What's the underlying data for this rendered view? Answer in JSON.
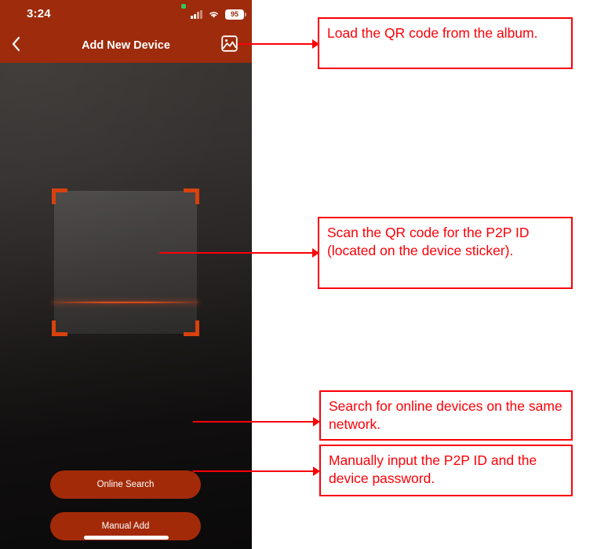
{
  "phone": {
    "status_bar": {
      "time": "3:24",
      "battery_level": "95",
      "signal_icon": "cellular-signal-icon",
      "wifi_icon": "wifi-icon",
      "battery_icon": "battery-icon",
      "privacy_icon": "green-privacy-dot-icon"
    },
    "nav_bar": {
      "title": "Add New Device",
      "back_icon": "chevron-left-icon",
      "album_icon": "photo-album-icon"
    },
    "scanner": {
      "frame_icon": "qr-scan-frame",
      "scanline_icon": "scan-line"
    },
    "buttons": [
      {
        "label": "Online Search",
        "name": "online-search-button"
      },
      {
        "label": "Manual Add",
        "name": "manual-add-button"
      }
    ],
    "home_indicator": "home-indicator"
  },
  "annotations": [
    {
      "text": "Load the QR code from the album."
    },
    {
      "text": "Scan the QR code for the P2P ID (located on the device sticker)."
    },
    {
      "text": "Search for online devices on the same network."
    },
    {
      "text": "Manually input the P2P ID and the device password."
    }
  ],
  "colors": {
    "brand_red": "#9e2b0b",
    "button_red": "#a32a08",
    "frame_orange": "#d9410d",
    "annotation_red": "#fb0007",
    "preview_dark": "#0c0a0a",
    "privacy_green": "#35c759"
  }
}
